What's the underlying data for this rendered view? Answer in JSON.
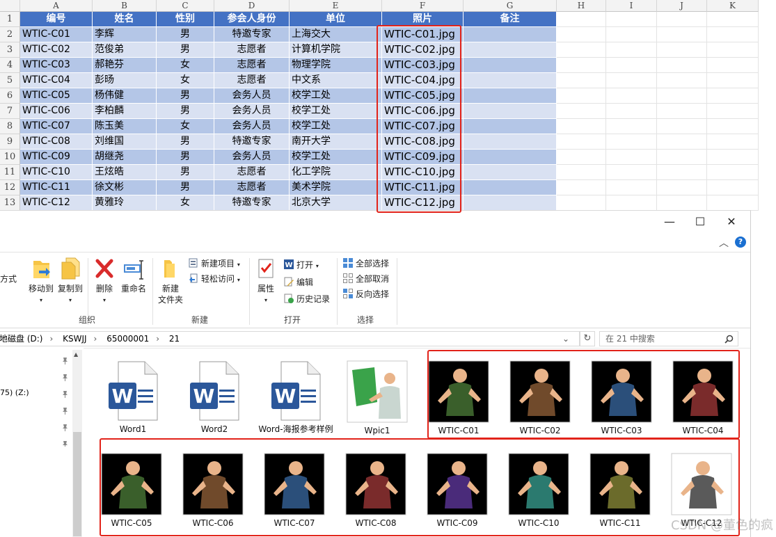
{
  "sheet": {
    "column_letters": [
      "A",
      "B",
      "C",
      "D",
      "E",
      "F",
      "G",
      "H",
      "I",
      "J",
      "K"
    ],
    "row_numbers": [
      "1",
      "2",
      "3",
      "4",
      "5",
      "6",
      "7",
      "8",
      "9",
      "10",
      "11",
      "12",
      "13"
    ],
    "headers": [
      "编号",
      "姓名",
      "性别",
      "参会人身份",
      "单位",
      "照片",
      "备注"
    ],
    "rows": [
      [
        "WTIC-C01",
        "李辉",
        "男",
        "特邀专家",
        "上海交大",
        "WTIC-C01.jpg",
        ""
      ],
      [
        "WTIC-C02",
        "范俊弟",
        "男",
        "志愿者",
        "计算机学院",
        "WTIC-C02.jpg",
        ""
      ],
      [
        "WTIC-C03",
        "郝艳芬",
        "女",
        "志愿者",
        "物理学院",
        "WTIC-C03.jpg",
        ""
      ],
      [
        "WTIC-C04",
        "彭旸",
        "女",
        "志愿者",
        "中文系",
        "WTIC-C04.jpg",
        ""
      ],
      [
        "WTIC-C05",
        "杨伟健",
        "男",
        "会务人员",
        "校学工处",
        "WTIC-C05.jpg",
        ""
      ],
      [
        "WTIC-C06",
        "李柏麟",
        "男",
        "会务人员",
        "校学工处",
        "WTIC-C06.jpg",
        ""
      ],
      [
        "WTIC-C07",
        "陈玉美",
        "女",
        "会务人员",
        "校学工处",
        "WTIC-C07.jpg",
        ""
      ],
      [
        "WTIC-C08",
        "刘维国",
        "男",
        "特邀专家",
        "南开大学",
        "WTIC-C08.jpg",
        ""
      ],
      [
        "WTIC-C09",
        "胡继尧",
        "男",
        "会务人员",
        "校学工处",
        "WTIC-C09.jpg",
        ""
      ],
      [
        "WTIC-C10",
        "王炫皓",
        "男",
        "志愿者",
        "化工学院",
        "WTIC-C10.jpg",
        ""
      ],
      [
        "WTIC-C11",
        "徐文彬",
        "男",
        "志愿者",
        "美术学院",
        "WTIC-C11.jpg",
        ""
      ],
      [
        "WTIC-C12",
        "黄雅玲",
        "女",
        "特邀专家",
        "北京大学",
        "WTIC-C12.jpg",
        ""
      ]
    ]
  },
  "explorer": {
    "window_buttons": {
      "minimize": "—",
      "maximize": "☐",
      "close": "✕",
      "expand": "︿",
      "help": "?"
    },
    "ribbon": {
      "partial_left": "方式",
      "move_to": "移动到",
      "copy_to": "复制到",
      "delete": "删除",
      "rename": "重命名",
      "group_organize": "组织",
      "new_folder_l1": "新建",
      "new_folder_l2": "文件夹",
      "new_item": "新建项目",
      "easy_access": "轻松访问",
      "group_new": "新建",
      "properties": "属性",
      "open": "打开",
      "edit": "编辑",
      "history": "历史记录",
      "group_open": "打开",
      "select_all": "全部选择",
      "select_none": "全部取消",
      "invert_selection": "反向选择",
      "group_select": "选择"
    },
    "address": {
      "segments": [
        "地磁盘 (D:)",
        "KSWJJ",
        "65000001",
        "21"
      ],
      "separator": "›",
      "dropdown": "⌄",
      "refresh": "↻"
    },
    "search_placeholder": "在 21 中搜索",
    "nav": {
      "drive_z": "75) (Z:)"
    },
    "files_row1": [
      {
        "name": "Word1",
        "type": "word"
      },
      {
        "name": "Word2",
        "type": "word"
      },
      {
        "name": "Word-海报参考样例",
        "type": "word"
      },
      {
        "name": "Wpic1",
        "type": "pic"
      },
      {
        "name": "WTIC-C01",
        "type": "pic"
      },
      {
        "name": "WTIC-C02",
        "type": "pic"
      },
      {
        "name": "WTIC-C03",
        "type": "pic"
      },
      {
        "name": "WTIC-C04",
        "type": "pic"
      }
    ],
    "files_row2": [
      {
        "name": "WTIC-C05",
        "type": "pic"
      },
      {
        "name": "WTIC-C06",
        "type": "pic"
      },
      {
        "name": "WTIC-C07",
        "type": "pic"
      },
      {
        "name": "WTIC-C08",
        "type": "pic"
      },
      {
        "name": "WTIC-C09",
        "type": "pic"
      },
      {
        "name": "WTIC-C10",
        "type": "pic"
      },
      {
        "name": "WTIC-C11",
        "type": "pic"
      },
      {
        "name": "WTIC-C12",
        "type": "pic"
      }
    ]
  },
  "watermark": "CSDN @董色的疯",
  "colors": {
    "header_blue": "#4472c4",
    "band_dark": "#b4c6e7",
    "band_light": "#d9e1f2",
    "highlight_red": "#e2231a",
    "word_blue": "#2b579a"
  }
}
